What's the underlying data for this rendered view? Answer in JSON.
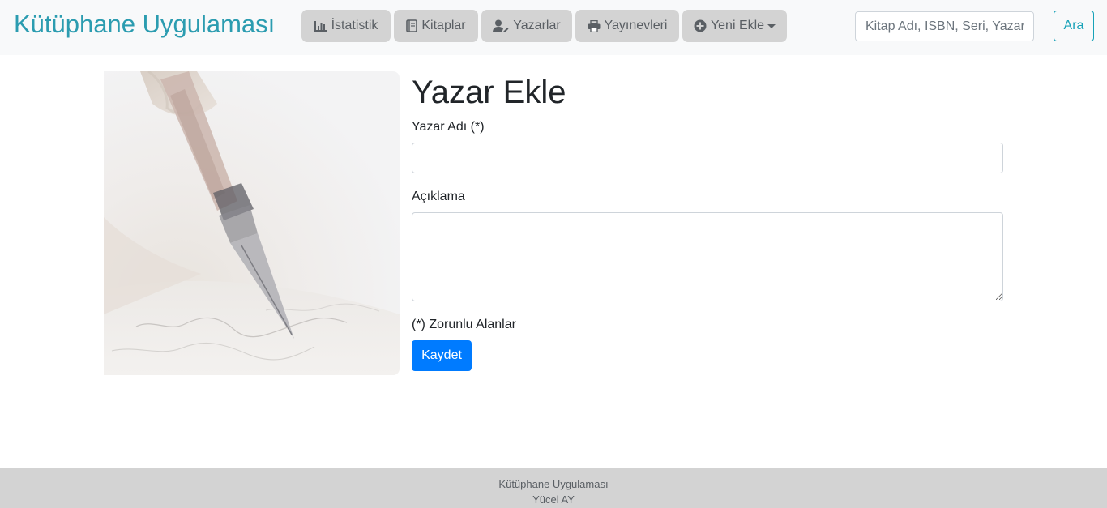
{
  "app": {
    "brand": "Kütüphane Uygulaması"
  },
  "nav": {
    "items": [
      {
        "label": "İstatistik",
        "icon": "chart-bar-icon"
      },
      {
        "label": "Kitaplar",
        "icon": "book-icon"
      },
      {
        "label": "Yazarlar",
        "icon": "user-edit-icon"
      },
      {
        "label": "Yayınevleri",
        "icon": "printer-icon"
      },
      {
        "label": "Yeni Ekle",
        "icon": "plus-circle-icon",
        "dropdown": true
      }
    ]
  },
  "search": {
    "placeholder": "Kitap Adı, ISBN, Seri, Yazar...",
    "value": "",
    "button_label": "Ara"
  },
  "form": {
    "title": "Yazar Ekle",
    "name_label": "Yazar Adı (*)",
    "name_value": "",
    "description_label": "Açıklama",
    "description_value": "",
    "required_note": "(*) Zorunlu Alanlar",
    "save_label": "Kaydet"
  },
  "footer": {
    "line1": "Kütüphane Uygulaması",
    "line2": "Yücel AY"
  },
  "colors": {
    "brand": "#2b9cb0",
    "nav_button_bg": "#d3d3d3",
    "primary": "#007bff",
    "info": "#17a2b8",
    "footer_bg": "#d3d3d3"
  }
}
